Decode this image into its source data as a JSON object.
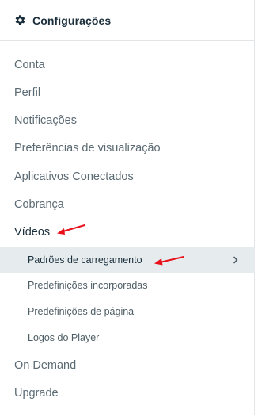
{
  "header": {
    "title": "Configurações",
    "icon": "gear-icon"
  },
  "nav": {
    "items": [
      {
        "label": "Conta"
      },
      {
        "label": "Perfil"
      },
      {
        "label": "Notificações"
      },
      {
        "label": "Preferências de visualização"
      },
      {
        "label": "Aplicativos Conectados"
      },
      {
        "label": "Cobrança"
      },
      {
        "label": "Vídeos"
      },
      {
        "label": "On Demand"
      },
      {
        "label": "Upgrade"
      }
    ],
    "sub_items": [
      {
        "label": "Padrões de carregamento",
        "active": true
      },
      {
        "label": "Predefinições incorporadas"
      },
      {
        "label": "Predefinições de página"
      },
      {
        "label": "Logos do Player"
      }
    ]
  },
  "colors": {
    "annotation_arrow": "#e8101a",
    "active_bg": "#e6ebee"
  }
}
